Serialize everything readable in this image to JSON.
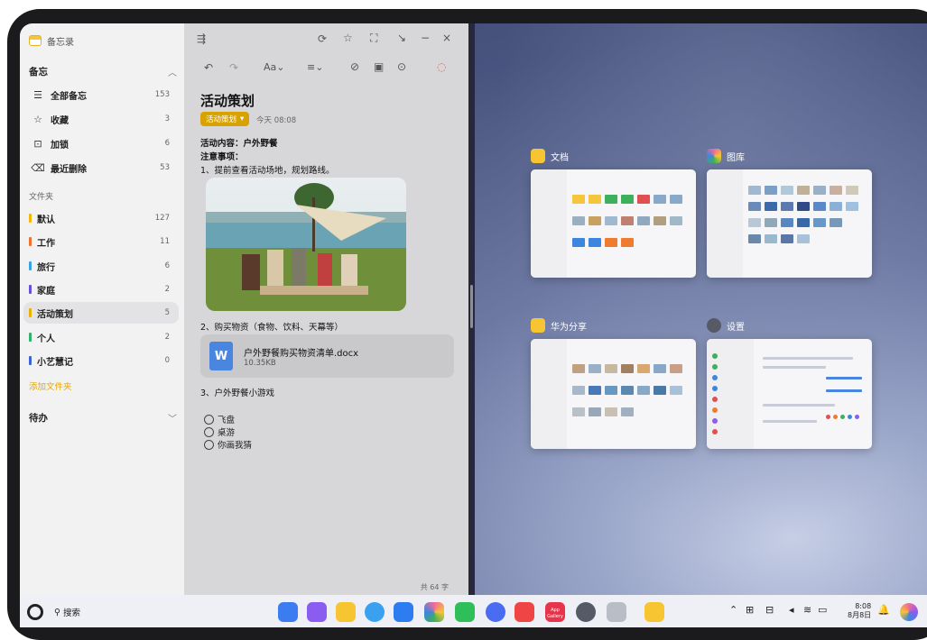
{
  "sidebar": {
    "app_title": "备忘录",
    "section_notes": "备忘",
    "items": [
      {
        "icon": "document-icon",
        "glyph": "☰",
        "label": "全部备忘",
        "count": "153"
      },
      {
        "icon": "star-icon",
        "glyph": "☆",
        "label": "收藏",
        "count": "3"
      },
      {
        "icon": "lock-icon",
        "glyph": "🔒",
        "label": "加锁",
        "count": "6"
      },
      {
        "icon": "trash-icon",
        "glyph": "🗑",
        "label": "最近删除",
        "count": "53"
      }
    ],
    "folders_title": "文件夹",
    "folders": [
      {
        "label": "默认",
        "count": "127",
        "color": "#f2b705"
      },
      {
        "label": "工作",
        "count": "11",
        "color": "#f07030"
      },
      {
        "label": "旅行",
        "count": "6",
        "color": "#3aa3e3"
      },
      {
        "label": "家庭",
        "count": "2",
        "color": "#6a4fd8"
      },
      {
        "label": "活动策划",
        "count": "5",
        "color": "#e8b000"
      },
      {
        "label": "个人",
        "count": "2",
        "color": "#2fb36b"
      },
      {
        "label": "小艺慧记",
        "count": "0",
        "color": "#3a63d8"
      }
    ],
    "add_folder": "添加文件夹",
    "section_todo": "待办"
  },
  "editor": {
    "title": "活动策划",
    "tag": "活动策划",
    "time": "今天 08:08",
    "line1": "活动内容：户外野餐",
    "line2": "注意事项：",
    "line3": "1、提前查看活动场地，规划路线。",
    "line4": "2、购买物资（食物、饮料、天幕等）",
    "file_name": "户外野餐购买物资清单.docx",
    "file_size": "10.35KB",
    "file_icon_letter": "W",
    "line5": "3、户外野餐小游戏",
    "checklist": [
      "飞盘",
      "桌游",
      "你画我猜"
    ],
    "word_count": "共 64 字"
  },
  "recent_windows": [
    {
      "name": "文档",
      "icon": "docs-app-icon",
      "color": "#f7c531"
    },
    {
      "name": "图库",
      "icon": "gallery-app-icon",
      "color": "#e85b8a"
    },
    {
      "name": "华为分享",
      "icon": "share-app-icon",
      "color": "#f7c531"
    },
    {
      "name": "设置",
      "icon": "settings-app-icon",
      "color": "#555a66"
    }
  ],
  "dock": {
    "search_label": "搜索",
    "apps": [
      {
        "name": "app-grid-icon",
        "color": "#3b7cf0"
      },
      {
        "name": "multi-window-icon",
        "color": "#8a5cf0"
      },
      {
        "name": "files-icon",
        "color": "#f7c531"
      },
      {
        "name": "browser-icon",
        "color": "#3aa0f0"
      },
      {
        "name": "mail-icon",
        "color": "#2e7df0"
      },
      {
        "name": "gallery-icon",
        "color": "#f06a9a"
      },
      {
        "name": "messages-icon",
        "color": "#2fbf5a"
      },
      {
        "name": "music-icon",
        "color": "#4a6cf0"
      },
      {
        "name": "books-icon",
        "color": "#f04545"
      },
      {
        "name": "appgallery-icon",
        "color": "#e8344a"
      },
      {
        "name": "settings-icon",
        "color": "#555a66"
      },
      {
        "name": "trash-icon",
        "color": "#9aa0aa"
      },
      {
        "name": "notes-icon",
        "color": "#f7c531"
      }
    ],
    "appgallery_label": "App Gallery",
    "time": "8:08",
    "date": "8月8日"
  }
}
